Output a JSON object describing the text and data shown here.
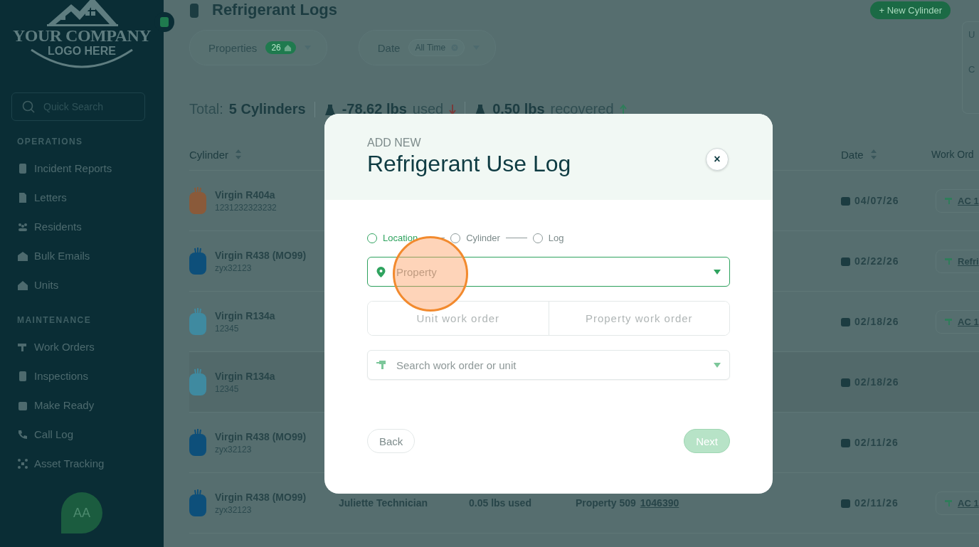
{
  "sidebar": {
    "logo": {
      "line_1": "YOUR COMPANY",
      "line_2": "LOGO HERE"
    },
    "search": {
      "placeholder": "Quick Search"
    },
    "sections": [
      {
        "title": "OPERATIONS",
        "items": [
          {
            "label": "Incident Reports",
            "kind": "document"
          },
          {
            "label": "Letters",
            "kind": "letter"
          },
          {
            "label": "Residents",
            "kind": "people"
          },
          {
            "label": "Bulk Emails",
            "kind": "mail"
          },
          {
            "label": "Units",
            "kind": "home"
          }
        ]
      },
      {
        "title": "MAINTENANCE",
        "items": [
          {
            "label": "Work Orders",
            "kind": "drill"
          },
          {
            "label": "Inspections",
            "kind": "document"
          },
          {
            "label": "Make Ready",
            "kind": "calendar"
          },
          {
            "label": "Call Log",
            "kind": "phone"
          },
          {
            "label": "Asset Tracking",
            "kind": "network"
          }
        ]
      }
    ],
    "avatar": "AA"
  },
  "page": {
    "title": "Refrigerant Logs",
    "new_button": "+ New Cylinder",
    "side_panel": [
      "U",
      "C"
    ],
    "filters": [
      {
        "label": "Properties",
        "kind": "count",
        "value": "26"
      },
      {
        "label": "Date",
        "kind": "chip",
        "value": "All Time"
      }
    ],
    "totals": {
      "label": "Total:",
      "count": "5 Cylinders",
      "used": "-78.62 lbs",
      "used_label": "used",
      "recovered": "0.50 lbs",
      "recovered_label": "recovered"
    },
    "table": {
      "columns": [
        "Cylinder",
        "Date",
        "Work Ord"
      ],
      "rows": [
        {
          "name": "Virgin R404a",
          "serial": "1231232323232",
          "color": "#8a5a3a",
          "date": "04/07/26",
          "work_order": "AC 1"
        },
        {
          "name": "Virgin R438 (MO99)",
          "serial": "zyx32123",
          "color": "#0d4f7a",
          "date": "02/22/26",
          "work_order": "Refri"
        },
        {
          "name": "Virgin R134a",
          "serial": "12345",
          "color": "#3f8aa0",
          "date": "02/18/26",
          "work_order": "AC 1"
        },
        {
          "name": "Virgin R134a",
          "serial": "12345",
          "color": "#3f8aa0",
          "date": "02/18/26"
        },
        {
          "name": "Virgin R438 (MO99)",
          "serial": "zyx32123",
          "color": "#0d4f7a",
          "date": "02/11/26"
        },
        {
          "name": "Virgin R438 (MO99)",
          "serial": "zyx32123",
          "color": "#0d4f7a",
          "technician": "Juliette Technician",
          "amount": "0.05 lbs used",
          "property": "Property 509",
          "property_link": "1046390",
          "date": "02/11/26",
          "work_order": "AC 1"
        }
      ]
    }
  },
  "modal": {
    "eyebrow": "ADD NEW",
    "title": "Refrigerant Use Log",
    "close": "×",
    "steps": [
      {
        "label": "Location",
        "selected": true
      },
      {
        "label": "Cylinder",
        "selected": false
      },
      {
        "label": "Log",
        "selected": false
      }
    ],
    "property_field": {
      "placeholder": "Property"
    },
    "order_types": [
      {
        "label": "Unit work order",
        "selected": false
      },
      {
        "label": "Property work order",
        "selected": false
      }
    ],
    "search_field": {
      "placeholder": "Search work order or unit"
    },
    "back": "Back",
    "next": {
      "label": "Next",
      "disabled": true
    }
  }
}
